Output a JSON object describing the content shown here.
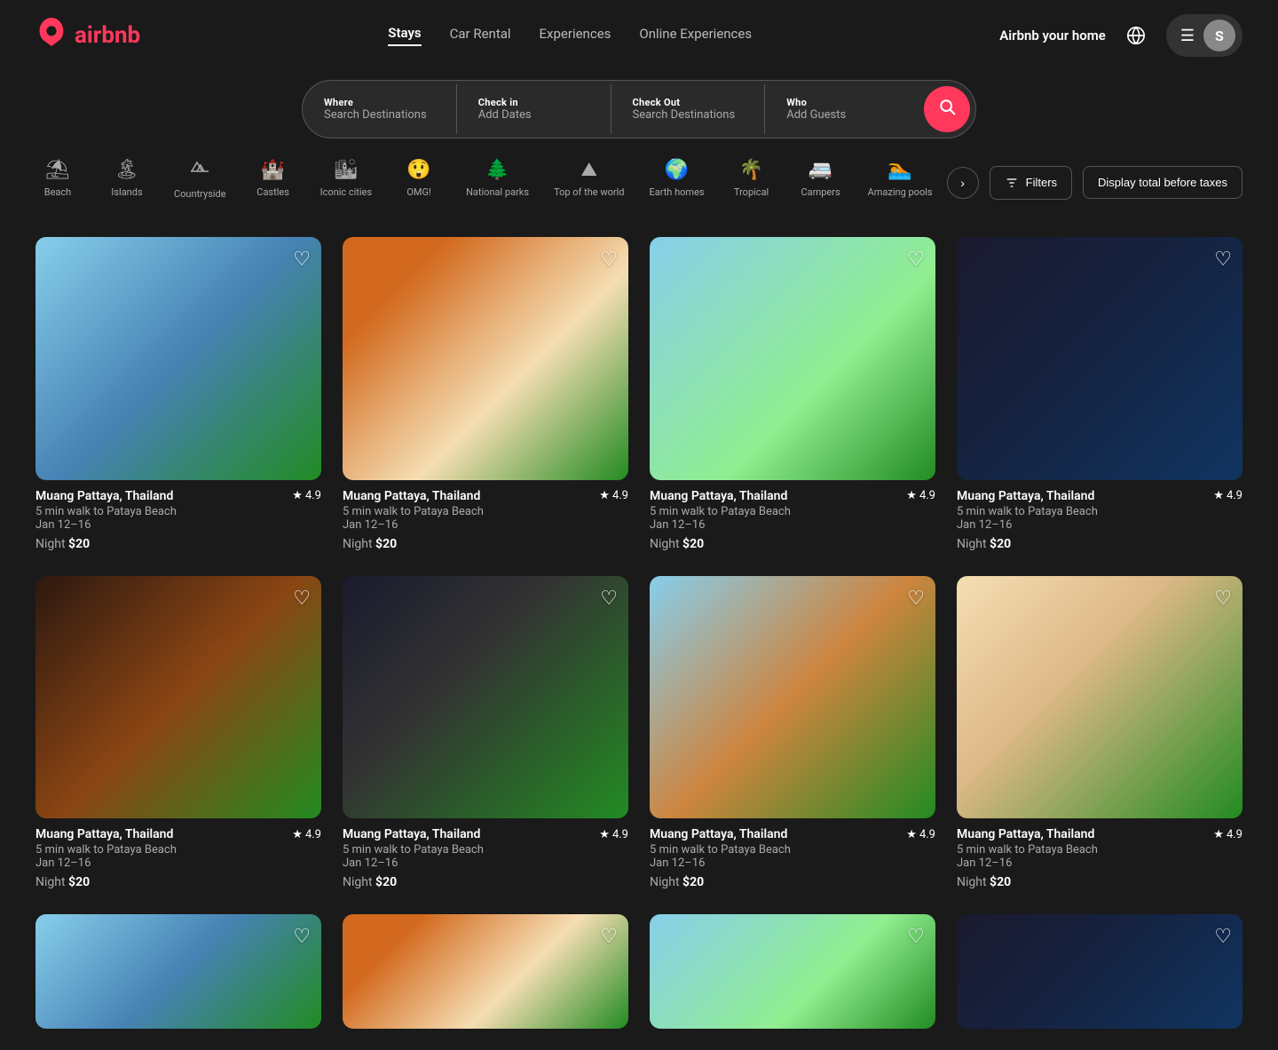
{
  "header": {
    "logo_icon": "🏠",
    "logo_text": "airbnb",
    "nav": [
      {
        "label": "Stays",
        "active": true
      },
      {
        "label": "Car Rental",
        "active": false
      },
      {
        "label": "Experiences",
        "active": false
      },
      {
        "label": "Online Experiences",
        "active": false
      }
    ],
    "airbnb_home_label": "Airbnb your home",
    "user_initial": "S"
  },
  "search": {
    "where_label": "Where",
    "where_value": "Search Destinations",
    "checkin_label": "Check in",
    "checkin_value": "Add Dates",
    "checkout_label": "Check Out",
    "checkout_value": "Search Destinations",
    "who_label": "Who",
    "who_value": "Add Guests"
  },
  "categories": [
    {
      "id": "beach",
      "label": "Beach",
      "icon": "⛱",
      "active": false
    },
    {
      "id": "islands",
      "label": "Islands",
      "icon": "🏝",
      "active": false
    },
    {
      "id": "countryside",
      "label": "Countryside",
      "icon": "🌿",
      "active": false
    },
    {
      "id": "castles",
      "label": "Castles",
      "icon": "🏰",
      "active": false
    },
    {
      "id": "iconic-cities",
      "label": "Iconic cities",
      "icon": "🏙",
      "active": false
    },
    {
      "id": "omg",
      "label": "OMG!",
      "icon": "😲",
      "active": false
    },
    {
      "id": "national-parks",
      "label": "National parks",
      "icon": "🌲",
      "active": false
    },
    {
      "id": "top-of-the-world",
      "label": "Top of the world",
      "icon": "⛰",
      "active": false
    },
    {
      "id": "earth-homes",
      "label": "Earth homes",
      "icon": "🌍",
      "active": false
    },
    {
      "id": "tropical",
      "label": "Tropical",
      "icon": "🌴",
      "active": false
    },
    {
      "id": "campers",
      "label": "Campers",
      "icon": "🚐",
      "active": false
    },
    {
      "id": "amazing-pools",
      "label": "Amazing pools",
      "icon": "🏊",
      "active": false
    }
  ],
  "filters_label": "Filters",
  "taxes_label": "Display total before taxes",
  "listings": [
    {
      "id": 1,
      "title": "Muang Pattaya, Thailand",
      "subtitle": "5 min walk to Pataya Beach",
      "dates": "Jan 12–16",
      "price_label": "Night",
      "price": "$20",
      "rating": "4.9",
      "img_class": "img-1"
    },
    {
      "id": 2,
      "title": "Muang Pattaya, Thailand",
      "subtitle": "5 min walk to Pataya Beach",
      "dates": "Jan 12–16",
      "price_label": "Night",
      "price": "$20",
      "rating": "4.9",
      "img_class": "img-2"
    },
    {
      "id": 3,
      "title": "Muang Pattaya, Thailand",
      "subtitle": "5 min walk to Pataya Beach",
      "dates": "Jan 12–16",
      "price_label": "Night",
      "price": "$20",
      "rating": "4.9",
      "img_class": "img-3"
    },
    {
      "id": 4,
      "title": "Muang Pattaya, Thailand",
      "subtitle": "5 min walk to Pataya Beach",
      "dates": "Jan 12–16",
      "price_label": "Night",
      "price": "$20",
      "rating": "4.9",
      "img_class": "img-4"
    },
    {
      "id": 5,
      "title": "Muang Pattaya, Thailand",
      "subtitle": "5 min walk to Pataya Beach",
      "dates": "Jan 12–16",
      "price_label": "Night",
      "price": "$20",
      "rating": "4.9",
      "img_class": "img-5"
    },
    {
      "id": 6,
      "title": "Muang Pattaya, Thailand",
      "subtitle": "5 min walk to Pataya Beach",
      "dates": "Jan 12–16",
      "price_label": "Night",
      "price": "$20",
      "rating": "4.9",
      "img_class": "img-6"
    },
    {
      "id": 7,
      "title": "Muang Pattaya, Thailand",
      "subtitle": "5 min walk to Pataya Beach",
      "dates": "Jan 12–16",
      "price_label": "Night",
      "price": "$20",
      "rating": "4.9",
      "img_class": "img-7"
    },
    {
      "id": 8,
      "title": "Muang Pattaya, Thailand",
      "subtitle": "5 min walk to Pataya Beach",
      "dates": "Jan 12–16",
      "price_label": "Night",
      "price": "$20",
      "rating": "4.9",
      "img_class": "img-8"
    }
  ]
}
